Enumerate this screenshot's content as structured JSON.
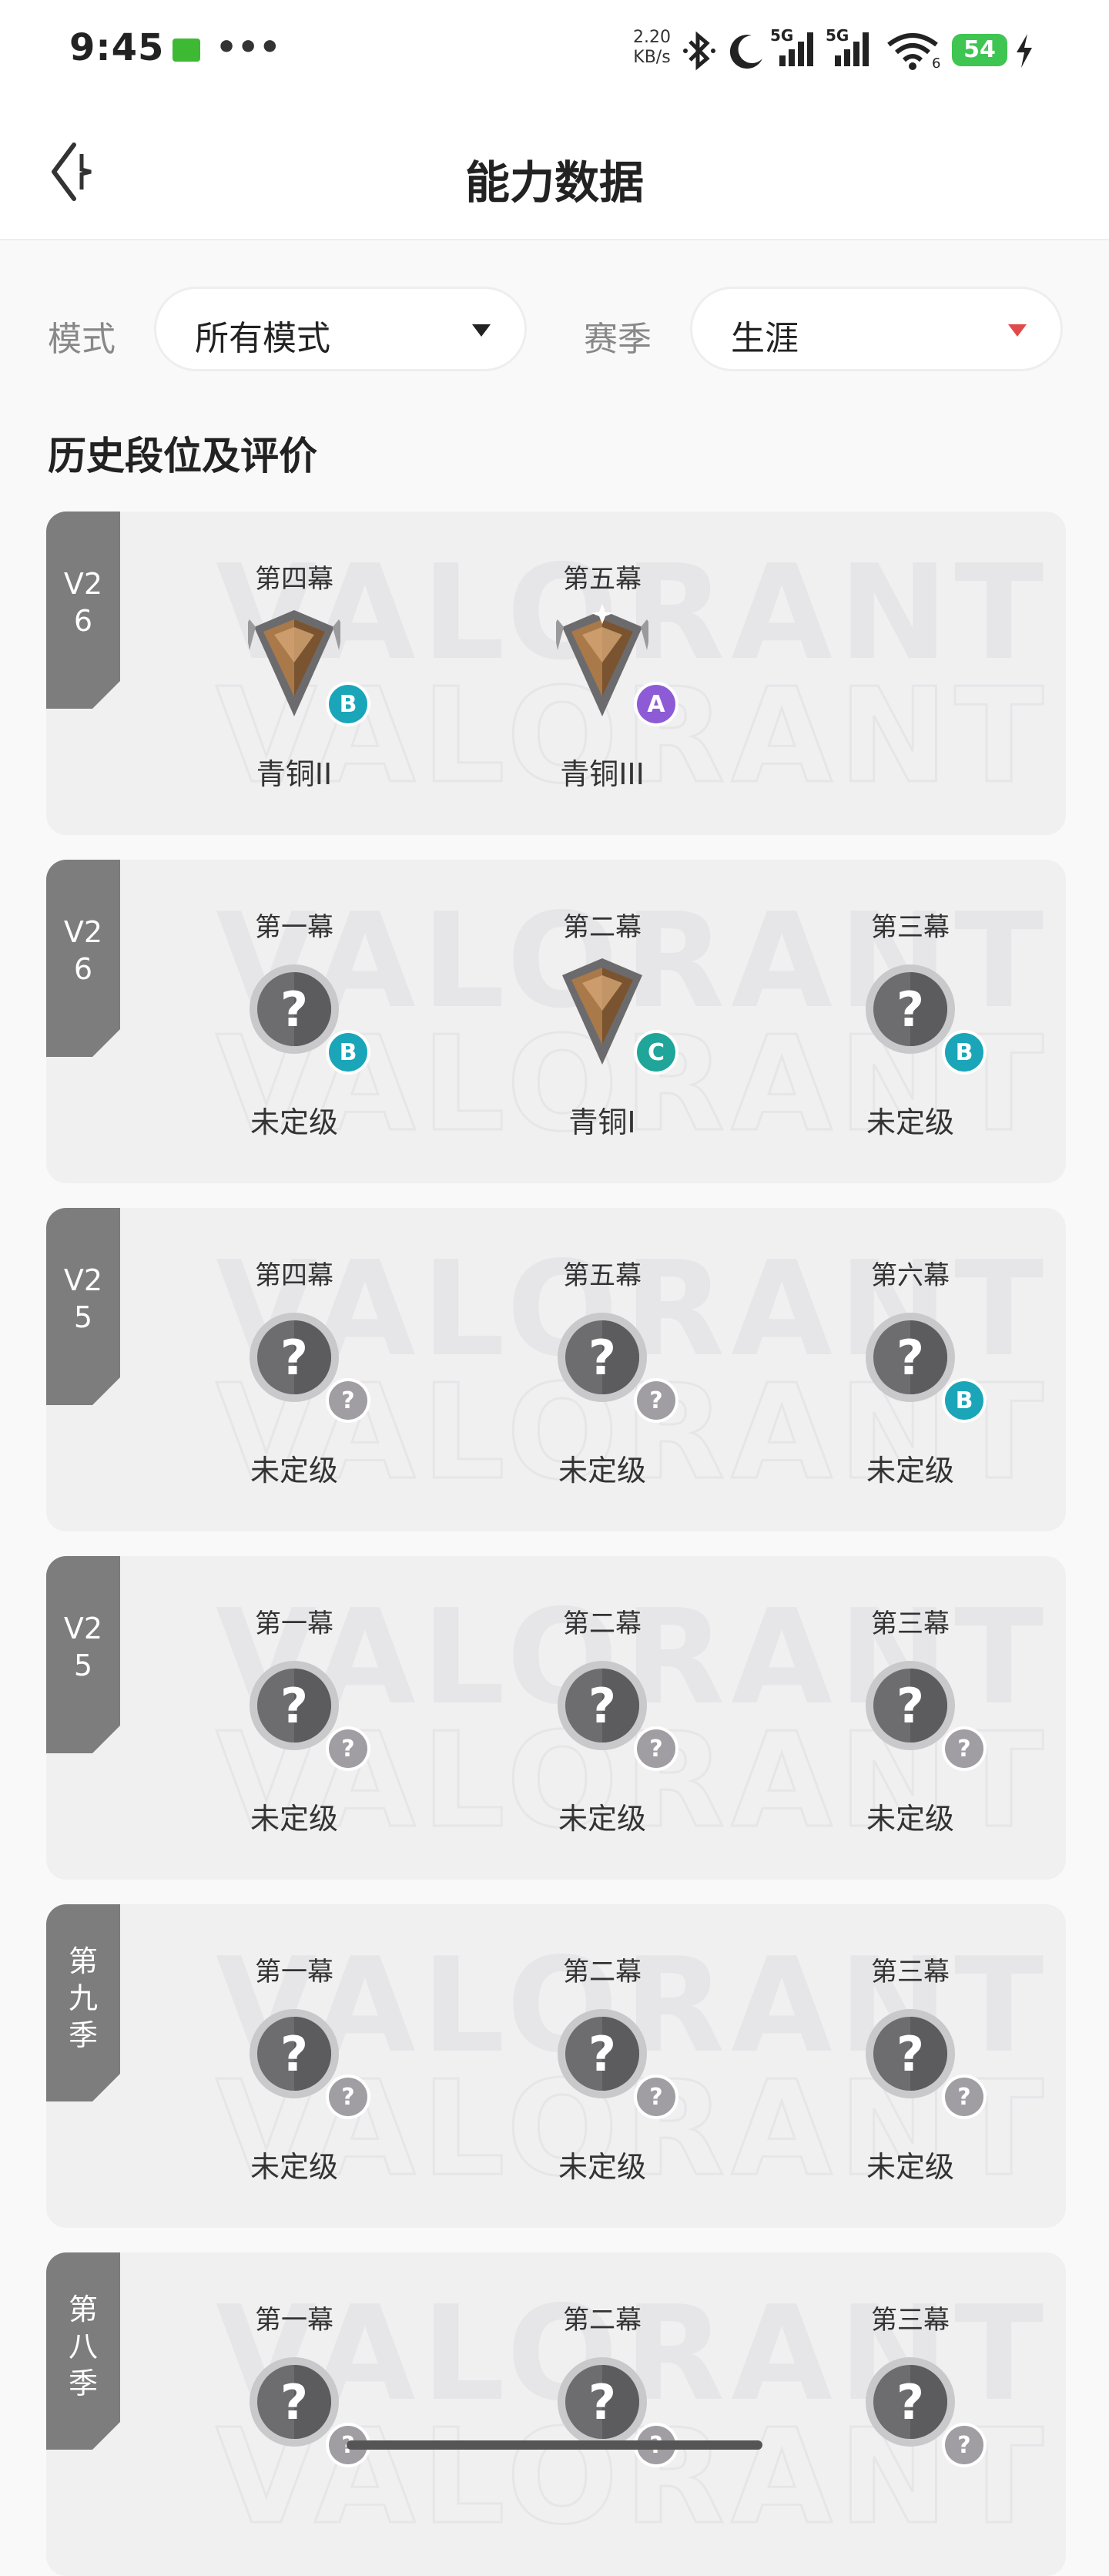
{
  "status_bar": {
    "time": "9:45",
    "dots": "•••",
    "speed_value": "2.20",
    "speed_unit": "KB/s",
    "signal1": "5G",
    "signal2": "5G",
    "wifi_sub": "6",
    "battery": "54"
  },
  "header": {
    "title": "能力数据"
  },
  "filters": {
    "mode_label": "模式",
    "mode_value": "所有模式",
    "season_label": "赛季",
    "season_value": "生涯"
  },
  "section_title": "历史段位及评价",
  "cards": [
    {
      "tag": [
        "V2",
        "6"
      ],
      "acts": [
        {
          "name": "第四幕",
          "rank": "青铜II",
          "emblem": "bronze2",
          "grade": "B"
        },
        {
          "name": "第五幕",
          "rank": "青铜III",
          "emblem": "bronze3",
          "grade": "A"
        }
      ]
    },
    {
      "tag": [
        "V2",
        "6"
      ],
      "acts": [
        {
          "name": "第一幕",
          "rank": "未定级",
          "emblem": "unranked",
          "grade": "B"
        },
        {
          "name": "第二幕",
          "rank": "青铜I",
          "emblem": "bronze1",
          "grade": "C"
        },
        {
          "name": "第三幕",
          "rank": "未定级",
          "emblem": "unranked",
          "grade": "B"
        }
      ]
    },
    {
      "tag": [
        "V2",
        "5"
      ],
      "acts": [
        {
          "name": "第四幕",
          "rank": "未定级",
          "emblem": "unranked",
          "grade": "?"
        },
        {
          "name": "第五幕",
          "rank": "未定级",
          "emblem": "unranked",
          "grade": "?"
        },
        {
          "name": "第六幕",
          "rank": "未定级",
          "emblem": "unranked",
          "grade": "B"
        }
      ]
    },
    {
      "tag": [
        "V2",
        "5"
      ],
      "acts": [
        {
          "name": "第一幕",
          "rank": "未定级",
          "emblem": "unranked",
          "grade": "?"
        },
        {
          "name": "第二幕",
          "rank": "未定级",
          "emblem": "unranked",
          "grade": "?"
        },
        {
          "name": "第三幕",
          "rank": "未定级",
          "emblem": "unranked",
          "grade": "?"
        }
      ]
    },
    {
      "tag": [
        "第",
        "九",
        "季"
      ],
      "acts": [
        {
          "name": "第一幕",
          "rank": "未定级",
          "emblem": "unranked",
          "grade": "?"
        },
        {
          "name": "第二幕",
          "rank": "未定级",
          "emblem": "unranked",
          "grade": "?"
        },
        {
          "name": "第三幕",
          "rank": "未定级",
          "emblem": "unranked",
          "grade": "?"
        }
      ]
    },
    {
      "tag": [
        "第",
        "八",
        "季"
      ],
      "acts": [
        {
          "name": "第一幕",
          "rank": "",
          "emblem": "unranked",
          "grade": "?"
        },
        {
          "name": "第二幕",
          "rank": "",
          "emblem": "unranked",
          "grade": "?"
        },
        {
          "name": "第三幕",
          "rank": "",
          "emblem": "unranked",
          "grade": "?"
        }
      ]
    }
  ],
  "watermark_text": "VALORANT",
  "colors": {
    "tag_bg": "#7d7d7e",
    "grade_B": "#1aa6b8",
    "grade_A": "#8e5bd6",
    "grade_C": "#1fa59a",
    "grade_unknown": "#a09ea3",
    "bronze": "#a9794a",
    "dropdown_arrow_mode": "#222222",
    "dropdown_arrow_season": "#e24a4a"
  }
}
